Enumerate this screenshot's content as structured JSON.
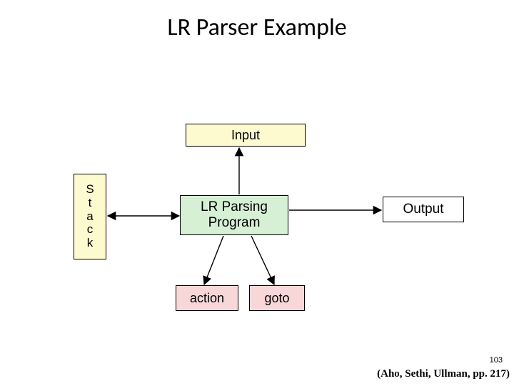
{
  "title": "LR Parser Example",
  "boxes": {
    "input": "Input",
    "stack_letters": [
      "S",
      "t",
      "a",
      "c",
      "k"
    ],
    "program_line1": "LR Parsing",
    "program_line2": "Program",
    "output": "Output",
    "action": "action",
    "goto": "goto"
  },
  "footer": {
    "slide_number": "103",
    "citation": "(Aho, Sethi, Ullman, pp. 217)"
  }
}
